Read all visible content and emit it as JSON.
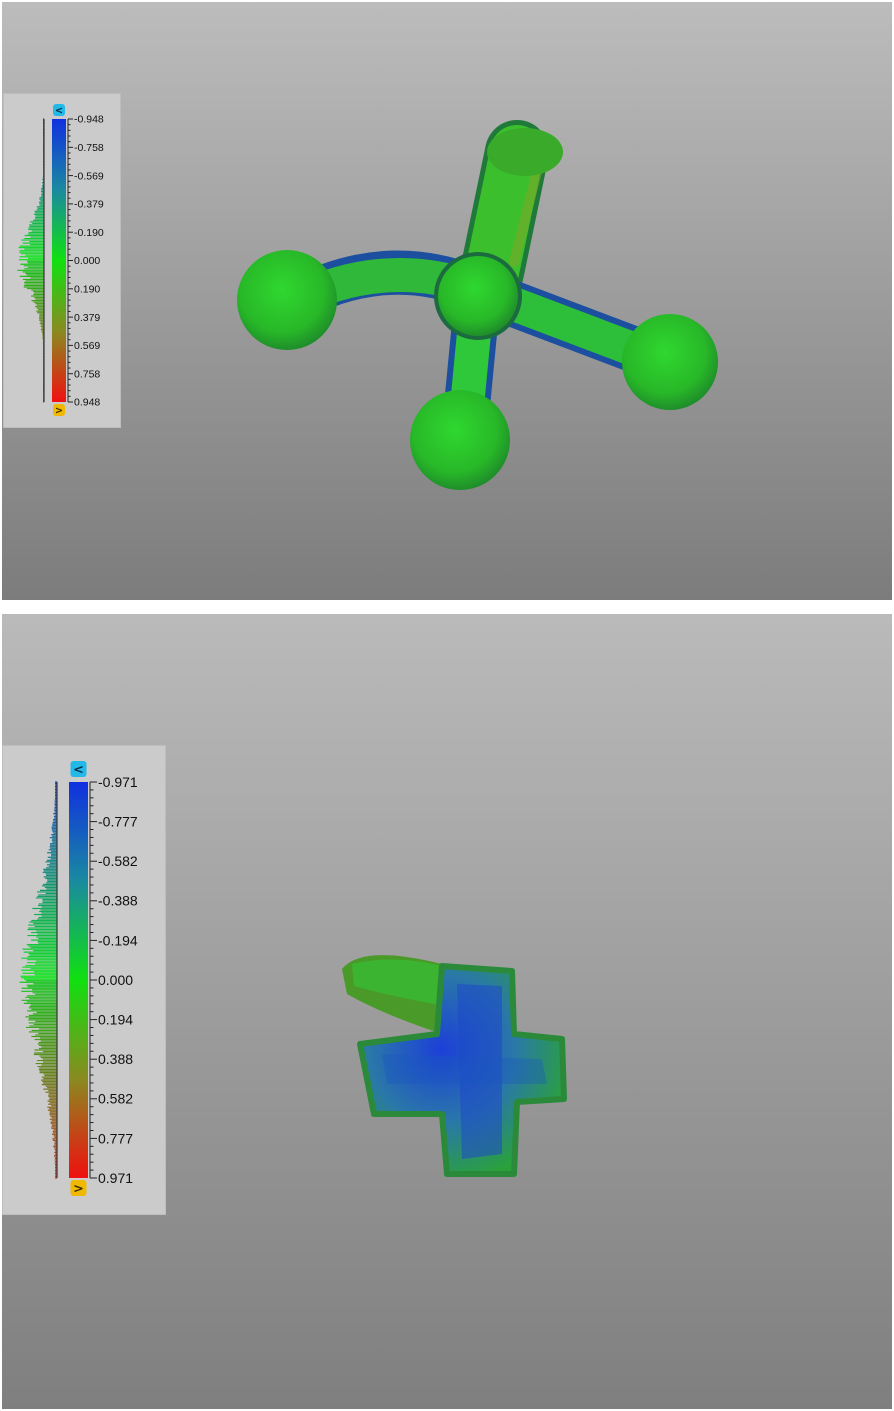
{
  "views": [
    {
      "id": "top",
      "legend": {
        "up_button": "<",
        "down_button": ">",
        "ticks": [
          "-0.948",
          "-0.758",
          "-0.569",
          "-0.379",
          "-0.190",
          "0.000",
          "0.190",
          "0.379",
          "0.569",
          "0.758",
          "0.948"
        ]
      }
    },
    {
      "id": "bottom",
      "legend": {
        "up_button": "<",
        "down_button": ">",
        "ticks": [
          "-0.971",
          "-0.777",
          "-0.582",
          "-0.388",
          "-0.194",
          "0.000",
          "0.194",
          "0.388",
          "0.582",
          "0.777",
          "0.971"
        ]
      }
    }
  ],
  "colors": {
    "scale_blue": "#1030e0",
    "scale_green": "#10e010",
    "scale_red": "#f01010",
    "up_badge": "#22b8e8",
    "down_badge": "#f0b800"
  }
}
